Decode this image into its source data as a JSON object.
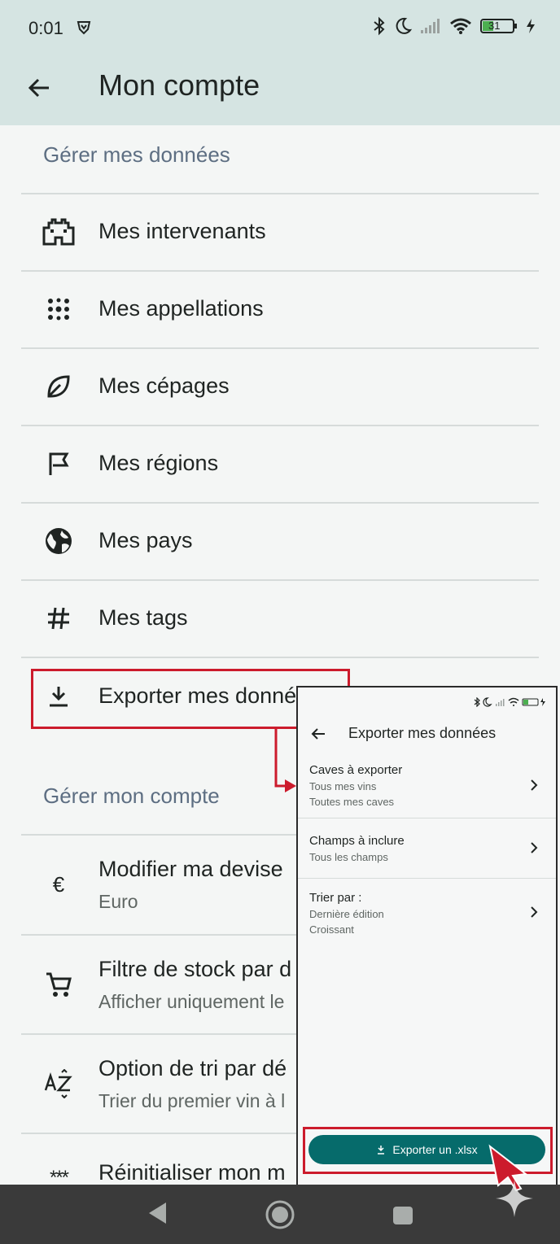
{
  "status_bar": {
    "time": "0:01",
    "battery": "31"
  },
  "appbar": {
    "title": "Mon compte"
  },
  "section1": {
    "title": "Gérer mes données",
    "items": [
      {
        "label": "Mes intervenants",
        "icon": "castle-icon"
      },
      {
        "label": "Mes appellations",
        "icon": "dots-grid-icon"
      },
      {
        "label": "Mes cépages",
        "icon": "leaf-icon"
      },
      {
        "label": "Mes régions",
        "icon": "flag-icon"
      },
      {
        "label": "Mes pays",
        "icon": "globe-icon"
      },
      {
        "label": "Mes tags",
        "icon": "hashtag-icon"
      },
      {
        "label": "Exporter mes données",
        "icon": "download-icon"
      }
    ]
  },
  "section2": {
    "title": "Gérer mon compte",
    "items": [
      {
        "label": "Modifier ma devise",
        "sub": "Euro",
        "icon": "euro-icon"
      },
      {
        "label": "Filtre de stock par d",
        "sub": "Afficher uniquement le",
        "icon": "cart-icon"
      },
      {
        "label": "Option de tri par dé",
        "sub": "Trier du premier vin à l",
        "icon": "sort-az-icon"
      },
      {
        "label": "Réinitialiser mon m",
        "icon": "password-icon"
      }
    ]
  },
  "inset": {
    "title": "Exporter mes données",
    "items": [
      {
        "title": "Caves à exporter",
        "subs": [
          "Tous mes vins",
          "Toutes mes caves"
        ]
      },
      {
        "title": "Champs à inclure",
        "subs": [
          "Tous les champs"
        ]
      },
      {
        "title": "Trier par :",
        "subs": [
          "Dernière édition",
          "Croissant"
        ]
      }
    ],
    "export_button": "Exporter un .xlsx"
  },
  "colors": {
    "accent": "#066b6b",
    "highlight": "#cc1b2c",
    "appbar": "#d5e4e2"
  }
}
